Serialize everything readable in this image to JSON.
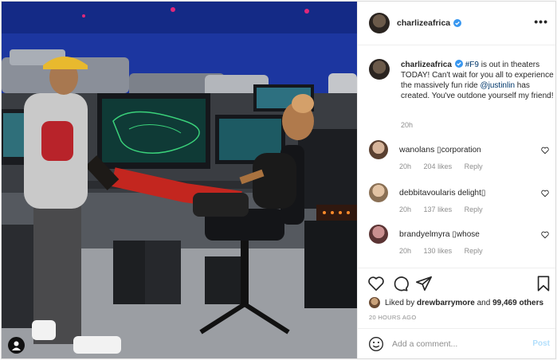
{
  "post": {
    "author": "charlizeafrica",
    "caption": {
      "username": "charlizeafrica",
      "text_hashtag": "#F9",
      "text_part1": " is out in theaters TODAY! Can't wait for you all to experience the massively fun ride ",
      "mention": "@justinlin",
      "text_part2": " has created. You've outdone yourself my friend!",
      "timestamp": "20h"
    },
    "comments": [
      {
        "username": "wanolans",
        "text": "▯corporation",
        "time": "20h",
        "likes": "204 likes",
        "reply": "Reply"
      },
      {
        "username": "debbitavoularis",
        "text": "delight▯",
        "time": "20h",
        "likes": "137 likes",
        "reply": "Reply"
      },
      {
        "username": "brandyelmyra",
        "text": "▯whose",
        "time": "20h",
        "likes": "130 likes",
        "reply": "Reply"
      }
    ],
    "likes": {
      "prefix": "Liked by ",
      "user": "drewbarrymore",
      "middle": " and ",
      "count": "99,469 others"
    },
    "date": "20 HOURS AGO",
    "add_comment": {
      "placeholder": "Add a comment...",
      "post_label": "Post"
    },
    "more_label": "•••"
  },
  "icons": {
    "like": "heart-icon",
    "comment": "comment-icon",
    "share": "paper-plane-icon",
    "save": "bookmark-icon",
    "emoji": "smiley-icon",
    "verified": "verified-badge-icon",
    "options": "more-options-icon",
    "user_tag": "user-tag-icon"
  },
  "colors": {
    "verified": "#3897f0",
    "link": "#00376b",
    "post_disabled": "#b2dffc",
    "muted": "#8e8e8e"
  }
}
